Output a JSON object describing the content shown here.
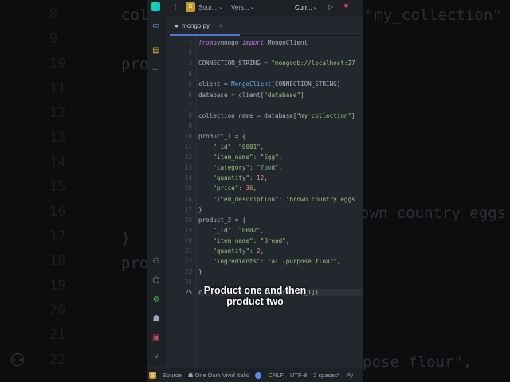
{
  "background": {
    "line_numbers": [
      "8",
      "9",
      "10",
      "11",
      "12",
      "13",
      "14",
      "15",
      "16",
      "17",
      "18",
      "19",
      "20",
      "21",
      "22"
    ],
    "left_fragments": [
      "col",
      "pro",
      "}",
      "pro"
    ],
    "right_fragments": [
      "\"my_collection\"",
      "own country eggs",
      "pose flour\","
    ]
  },
  "topbar": {
    "project_badge": "S",
    "project": "Sour...",
    "vcs": "Vers...",
    "run_config": "Curr..."
  },
  "tab": {
    "label": "mongo.py",
    "close": "×"
  },
  "code": {
    "lines": [
      [
        [
          "kw",
          "from"
        ],
        [
          "",
          "pymongo "
        ],
        [
          "kw",
          "import"
        ],
        [
          "",
          " MongoClient"
        ]
      ],
      [],
      [
        [
          "",
          "CONNECTION_STRING = "
        ],
        [
          "st",
          "\"mongodb://localhost:27"
        ]
      ],
      [],
      [
        [
          "",
          "client = "
        ],
        [
          "cls",
          "MongoClient"
        ],
        [
          "",
          "(CONNECTION_STRING)"
        ]
      ],
      [
        [
          "",
          "database = client["
        ],
        [
          "st",
          "\"database\""
        ],
        [
          "",
          "]"
        ]
      ],
      [],
      [
        [
          "",
          "collection_name = database["
        ],
        [
          "st",
          "\"my_collection\""
        ],
        [
          "",
          "]"
        ]
      ],
      [],
      [
        [
          "",
          "product_1 = {"
        ]
      ],
      [
        [
          "",
          "    "
        ],
        [
          "st",
          "\"_id\""
        ],
        [
          "",
          ": "
        ],
        [
          "st",
          "\"0001\""
        ],
        [
          "",
          ","
        ]
      ],
      [
        [
          "",
          "    "
        ],
        [
          "st",
          "\"item_name\""
        ],
        [
          "",
          ": "
        ],
        [
          "st",
          "\"Egg\""
        ],
        [
          "",
          ","
        ]
      ],
      [
        [
          "",
          "    "
        ],
        [
          "st",
          "\"category\""
        ],
        [
          "",
          ": "
        ],
        [
          "st",
          "\"food\""
        ],
        [
          "",
          ","
        ]
      ],
      [
        [
          "",
          "    "
        ],
        [
          "st",
          "\"quantity\""
        ],
        [
          "",
          ": "
        ],
        [
          "nu",
          "12"
        ],
        [
          "",
          ","
        ]
      ],
      [
        [
          "",
          "    "
        ],
        [
          "st",
          "\"price\""
        ],
        [
          "",
          ": "
        ],
        [
          "nu",
          "36"
        ],
        [
          "",
          ","
        ]
      ],
      [
        [
          "",
          "    "
        ],
        [
          "st",
          "\"item_description\""
        ],
        [
          "",
          ": "
        ],
        [
          "st",
          "\"brown country eggs"
        ]
      ],
      [
        [
          "",
          "}"
        ]
      ],
      [
        [
          "",
          "product_2 = {"
        ]
      ],
      [
        [
          "",
          "    "
        ],
        [
          "st",
          "\"_id\""
        ],
        [
          "",
          ": "
        ],
        [
          "st",
          "\"0002\""
        ],
        [
          "",
          ","
        ]
      ],
      [
        [
          "",
          "    "
        ],
        [
          "st",
          "\"item_name\""
        ],
        [
          "",
          ": "
        ],
        [
          "st",
          "\"Bread\""
        ],
        [
          "",
          ","
        ]
      ],
      [
        [
          "",
          "    "
        ],
        [
          "st",
          "\"quantity\""
        ],
        [
          "",
          ": "
        ],
        [
          "nu",
          "2"
        ],
        [
          "",
          ","
        ]
      ],
      [
        [
          "",
          "    "
        ],
        [
          "st",
          "\"ingredients\""
        ],
        [
          "",
          ": "
        ],
        [
          "st",
          "\"all-purpose flour\""
        ],
        [
          "",
          ","
        ]
      ],
      [
        [
          "",
          "}"
        ]
      ],
      [],
      [
        [
          "",
          "c                    [product_1])"
        ]
      ]
    ]
  },
  "caption": [
    "Product one and then",
    "product two"
  ],
  "status": {
    "vcs_badge": "S",
    "branch": "Source",
    "theme": "One Dark Vivid Italic",
    "line_sep": "CRLF",
    "encoding": "UTF-8",
    "indent": "2 spaces*",
    "lang": "Py"
  }
}
